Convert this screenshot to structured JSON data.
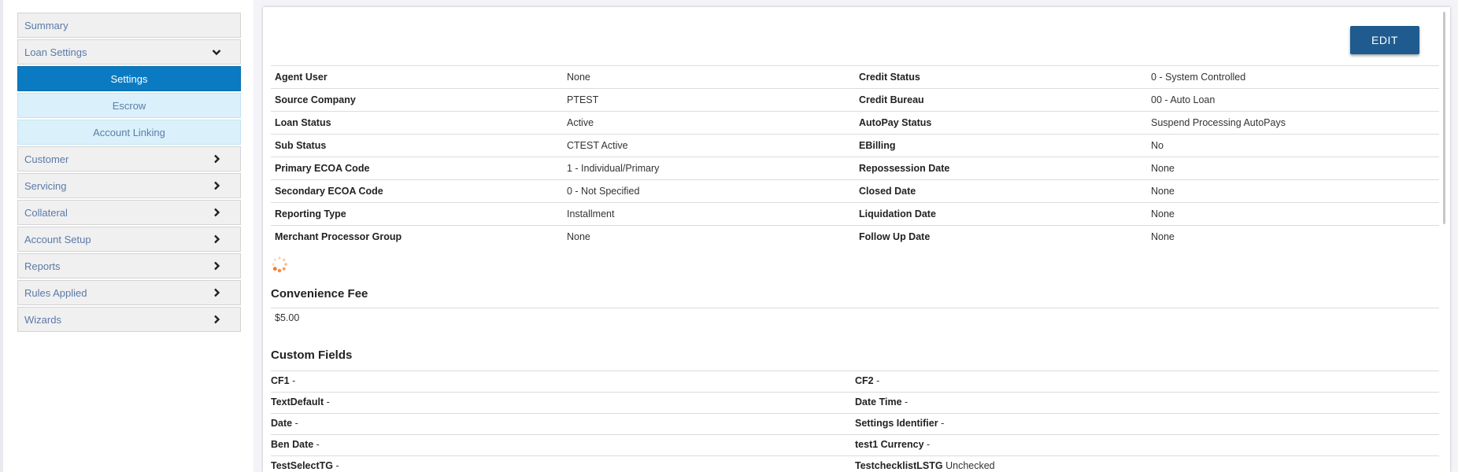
{
  "sidebar": {
    "items": [
      {
        "label": "Summary"
      },
      {
        "label": "Loan Settings"
      },
      {
        "label": "Customer"
      },
      {
        "label": "Servicing"
      },
      {
        "label": "Collateral"
      },
      {
        "label": "Account Setup"
      },
      {
        "label": "Reports"
      },
      {
        "label": "Rules Applied"
      },
      {
        "label": "Wizards"
      }
    ],
    "sub_items": [
      {
        "label": "Settings"
      },
      {
        "label": "Escrow"
      },
      {
        "label": "Account Linking"
      }
    ]
  },
  "main": {
    "edit_label": "EDIT",
    "details": [
      {
        "l1": "Agent User",
        "v1": "None",
        "l2": "Credit Status",
        "v2": "0 - System Controlled"
      },
      {
        "l1": "Source Company",
        "v1": "PTEST",
        "l2": "Credit Bureau",
        "v2": "00 - Auto Loan"
      },
      {
        "l1": "Loan Status",
        "v1": "Active",
        "l2": "AutoPay Status",
        "v2": "Suspend Processing AutoPays"
      },
      {
        "l1": "Sub Status",
        "v1": "CTEST Active",
        "l2": "EBilling",
        "v2": "No"
      },
      {
        "l1": "Primary ECOA Code",
        "v1": "1 - Individual/Primary",
        "l2": "Repossession Date",
        "v2": "None"
      },
      {
        "l1": "Secondary ECOA Code",
        "v1": "0 - Not Specified",
        "l2": "Closed Date",
        "v2": "None"
      },
      {
        "l1": "Reporting Type",
        "v1": "Installment",
        "l2": "Liquidation Date",
        "v2": "None"
      },
      {
        "l1": "Merchant Processor Group",
        "v1": "None",
        "l2": "Follow Up Date",
        "v2": "None"
      }
    ],
    "convenience_fee": {
      "title": "Convenience Fee",
      "value": "$5.00"
    },
    "custom_fields": {
      "title": "Custom Fields",
      "rows": [
        {
          "l1": "CF1",
          "v1": "-",
          "l2": "CF2",
          "v2": "-"
        },
        {
          "l1": "TextDefault",
          "v1": "-",
          "l2": "Date Time",
          "v2": "-"
        },
        {
          "l1": "Date",
          "v1": "-",
          "l2": "Settings Identifier",
          "v2": "-"
        },
        {
          "l1": "Ben Date",
          "v1": "-",
          "l2": "test1 Currency",
          "v2": "-"
        },
        {
          "l1": "TestSelectTG",
          "v1": "-",
          "l2": "TestchecklistLSTG",
          "v2": "Unchecked"
        }
      ]
    }
  },
  "colors": {
    "accent": "#0a7bc2",
    "button": "#1f5b8e",
    "spinner": "#f07a2a"
  },
  "icons": {
    "collapse": "chevron-down-icon",
    "expand": "chevron-right-icon",
    "loading": "spinner-icon"
  }
}
